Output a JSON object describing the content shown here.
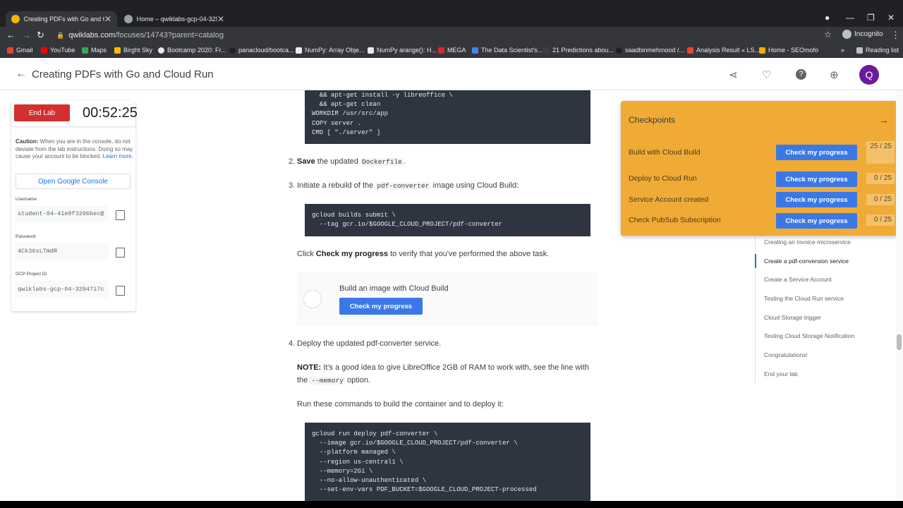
{
  "browser": {
    "tabs": [
      {
        "title": "Creating PDFs with Go and Clou",
        "active": true
      },
      {
        "title": "Home – qwiklabs-gcp-04-329...",
        "active": false
      }
    ],
    "url_host": "qwiklabs.com",
    "url_path": "/focuses/14743?parent=catalog",
    "incognito_label": "Incognito",
    "bookmarks": [
      "Gmail",
      "YouTube",
      "Maps",
      "Birght Sky",
      "Bootcamp 2020: Fr...",
      "panacloud/bootca...",
      "NumPy: Array Obje...",
      "NumPy arange(): H...",
      "MEGA",
      "The Data Scientist's...",
      "21 Predictions abou...",
      "saadbinmehmood /...",
      "Analysis Result « LS...",
      "Home - SEOmofo"
    ],
    "reading_list": "Reading list"
  },
  "appbar": {
    "title": "Creating PDFs with Go and Cloud Run",
    "avatar_letter": "Q"
  },
  "lab_panel": {
    "end_lab": "End Lab",
    "timer": "00:52:25",
    "caution_bold": "Caution:",
    "caution_text": "When you are in the console, do not deviate from the lab instructions. Doing so may cause your account to be blocked.",
    "learn_more": "Learn more.",
    "open_console": "Open Google Console",
    "username_label": "Username",
    "username": "student-04-41e0f3296bec@",
    "password_label": "Password",
    "password": "4Ck36sLTmdR",
    "project_label": "GCP Project ID",
    "project_id": "qwiklabs-gcp-04-3294717c"
  },
  "content": {
    "code1": "  && apt-get install -y libreoffice \\\n  && apt-get clean\nWORKDIR /usr/src/app\nCOPY server .\nCMD [ \"./server\" ]",
    "step2_num": "2.",
    "step2_bold": "Save",
    "step2_text": "the updated",
    "step2_code": "Dockerfile",
    "step2_end": ".",
    "step3_num": "3.",
    "step3_pre": "Initiate a rebuild of the",
    "step3_code": "pdf-converter",
    "step3_post": "image using Cloud Build:",
    "code2": "gcloud builds submit \\\n  --tag gcr.io/$GOOGLE_CLOUD_PROJECT/pdf-converter",
    "click_pre": "Click",
    "click_bold": "Check my progress",
    "click_post": "to verify that you've performed the above task.",
    "progress_title": "Build an image with Cloud Build",
    "progress_button": "Check my progress",
    "step4_num": "4.",
    "step4_text": "Deploy the updated pdf-converter service.",
    "note_bold": "NOTE:",
    "note_text": "It's a good idea to give LibreOffice 2GB of RAM to work with, see the line with",
    "note_line2_pre": "the",
    "note_code": "--memory",
    "note_line2_post": "option.",
    "run_text": "Run these commands to build the container and to deploy it:",
    "code3": "gcloud run deploy pdf-converter \\\n  --image gcr.io/$GOOGLE_CLOUD_PROJECT/pdf-converter \\\n  --platform managed \\\n  --region us-central1 \\\n  --memory=2Gi \\\n  --no-allow-unauthenticated \\\n  --set-env-vars PDF_BUCKET=$GOOGLE_CLOUD_PROJECT-processed"
  },
  "checkpoints": {
    "title": "Checkpoints",
    "button_label": "Check my progress",
    "items": [
      {
        "label": "Build with Cloud Build",
        "score": "25 / 25"
      },
      {
        "label": "Deploy to Cloud Run",
        "score": "0 / 25"
      },
      {
        "label": "Service Account created",
        "score": "0 / 25"
      },
      {
        "label": "Check PubSub Subscription",
        "score": "0 / 25"
      }
    ]
  },
  "toc": {
    "items": [
      {
        "label": "Creating an invoice microservice",
        "active": false
      },
      {
        "label": "Create a pdf-conversion service",
        "active": true
      },
      {
        "label": "Create a Service Account",
        "active": false
      },
      {
        "label": "Testing the Cloud Run service",
        "active": false
      },
      {
        "label": "Cloud Storage trigger",
        "active": false
      },
      {
        "label": "Testing Cloud Storage Notification",
        "active": false
      },
      {
        "label": "Congratulations!",
        "active": false
      },
      {
        "label": "End your lab",
        "active": false
      }
    ]
  },
  "colors": {
    "accent_blue": "#3b78e7",
    "end_lab_red": "#d32f2f",
    "checkpoint_bg": "#f0aa36",
    "avatar_purple": "#6a1b9a"
  }
}
